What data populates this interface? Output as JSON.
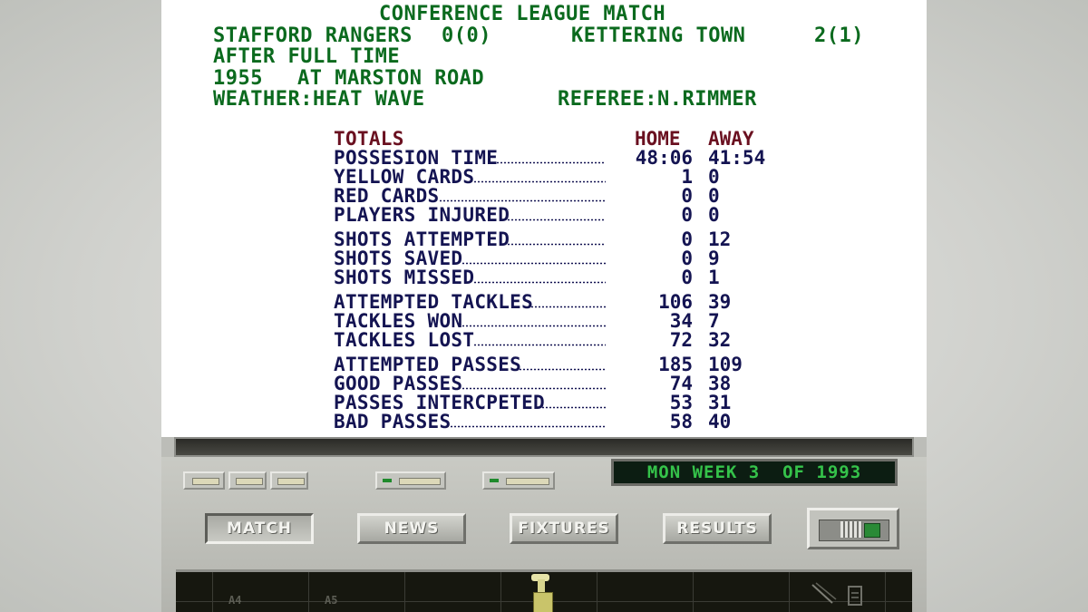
{
  "header": {
    "title": "CONFERENCE LEAGUE MATCH",
    "home_team": "STAFFORD RANGERS",
    "home_score": "0(0)",
    "away_team": "KETTERING TOWN",
    "away_score": "2(1)",
    "status": "AFTER FULL TIME",
    "attendance": "1955",
    "venue": "AT MARSTON ROAD",
    "weather": "WEATHER:HEAT WAVE",
    "referee": "REFEREE:N.RIMMER"
  },
  "stats": {
    "totals_label": "TOTALS",
    "home_label": "HOME",
    "away_label": "AWAY",
    "groups": [
      [
        {
          "label": "POSSESION TIME",
          "home": "48:06",
          "away": "41:54"
        },
        {
          "label": "YELLOW CARDS",
          "home": "1",
          "away": "0"
        },
        {
          "label": "RED CARDS",
          "home": "0",
          "away": "0"
        },
        {
          "label": "PLAYERS INJURED",
          "home": "0",
          "away": "0"
        }
      ],
      [
        {
          "label": "SHOTS ATTEMPTED",
          "home": "0",
          "away": "12"
        },
        {
          "label": "SHOTS SAVED",
          "home": "0",
          "away": "9"
        },
        {
          "label": "SHOTS MISSED",
          "home": "0",
          "away": "1"
        }
      ],
      [
        {
          "label": "ATTEMPTED TACKLES",
          "home": "106",
          "away": "39"
        },
        {
          "label": "TACKLES WON",
          "home": "34",
          "away": "7"
        },
        {
          "label": "TACKLES LOST",
          "home": "72",
          "away": "32"
        }
      ],
      [
        {
          "label": "ATTEMPTED PASSES",
          "home": "185",
          "away": "109"
        },
        {
          "label": "GOOD PASSES",
          "home": "74",
          "away": "38"
        },
        {
          "label": "PASSES INTERCPETED",
          "home": "53",
          "away": "31"
        },
        {
          "label": "BAD PASSES",
          "home": "58",
          "away": "40"
        }
      ]
    ]
  },
  "console": {
    "date_display": "MON WEEK 3  OF 1993",
    "buttons": {
      "match": "MATCH",
      "news": "NEWS",
      "fixtures": "FIXTURES",
      "results": "RESULTS"
    },
    "grid_labels": [
      "A4",
      "A5"
    ]
  },
  "colors": {
    "header_green": "#0b6a1e",
    "stat_navy": "#141452",
    "heading_maroon": "#6a1020",
    "lcd_green": "#35c24a"
  },
  "icons": [
    "desk-lamp-icon",
    "quill-pen-icon",
    "toggle-switch-icon"
  ]
}
